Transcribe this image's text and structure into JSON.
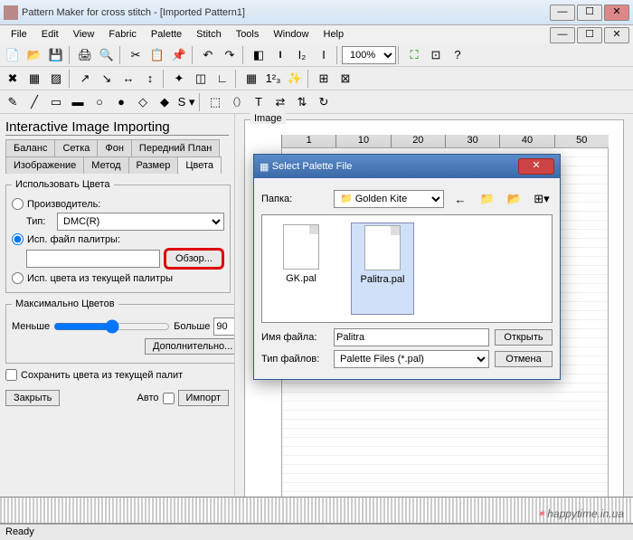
{
  "app": {
    "title": "Pattern Maker for cross stitch - [Imported Pattern1]"
  },
  "menu": [
    "File",
    "Edit",
    "View",
    "Fabric",
    "Palette",
    "Stitch",
    "Tools",
    "Window",
    "Help"
  ],
  "zoom": "100%",
  "panel": {
    "heading": "Interactive Image Importing",
    "tabs_row1": [
      "Баланс",
      "Сетка",
      "Фон",
      "Передний План"
    ],
    "tabs_row2": [
      "Изображение",
      "Метод",
      "Размер",
      "Цвета"
    ],
    "fieldset_colors": "Использовать Цвета",
    "r_manufacturer": "Производитель:",
    "type_label": "Тип:",
    "type_value": "DMC(R)",
    "r_palettefile": "Исп. файл палитры:",
    "browse": "Обзор...",
    "r_currentpalette": "Исп. цвета из текущей палитры",
    "fieldset_max": "Максимально Цветов",
    "less": "Меньше",
    "more": "Больше",
    "max_value": "90",
    "advanced": "Дополнительно...",
    "save_colors": "Сохранить цвета из текущей палит",
    "close": "Закрыть",
    "auto": "Авто",
    "import": "Импорт"
  },
  "canvas": {
    "label": "Image",
    "ruler": [
      "1",
      "10",
      "20",
      "30",
      "40",
      "50"
    ]
  },
  "dialog": {
    "title": "Select Palette File",
    "folder_label": "Папка:",
    "folder": "Golden Kite",
    "files": [
      {
        "name": "GK.pal",
        "selected": false
      },
      {
        "name": "Palitra.pal",
        "selected": true
      }
    ],
    "filename_label": "Имя файла:",
    "filename": "Palitra",
    "filetype_label": "Тип файлов:",
    "filetype": "Palette Files (*.pal)",
    "open": "Открыть",
    "cancel": "Отмена"
  },
  "status": "Ready",
  "watermark": "happytime.in.ua"
}
